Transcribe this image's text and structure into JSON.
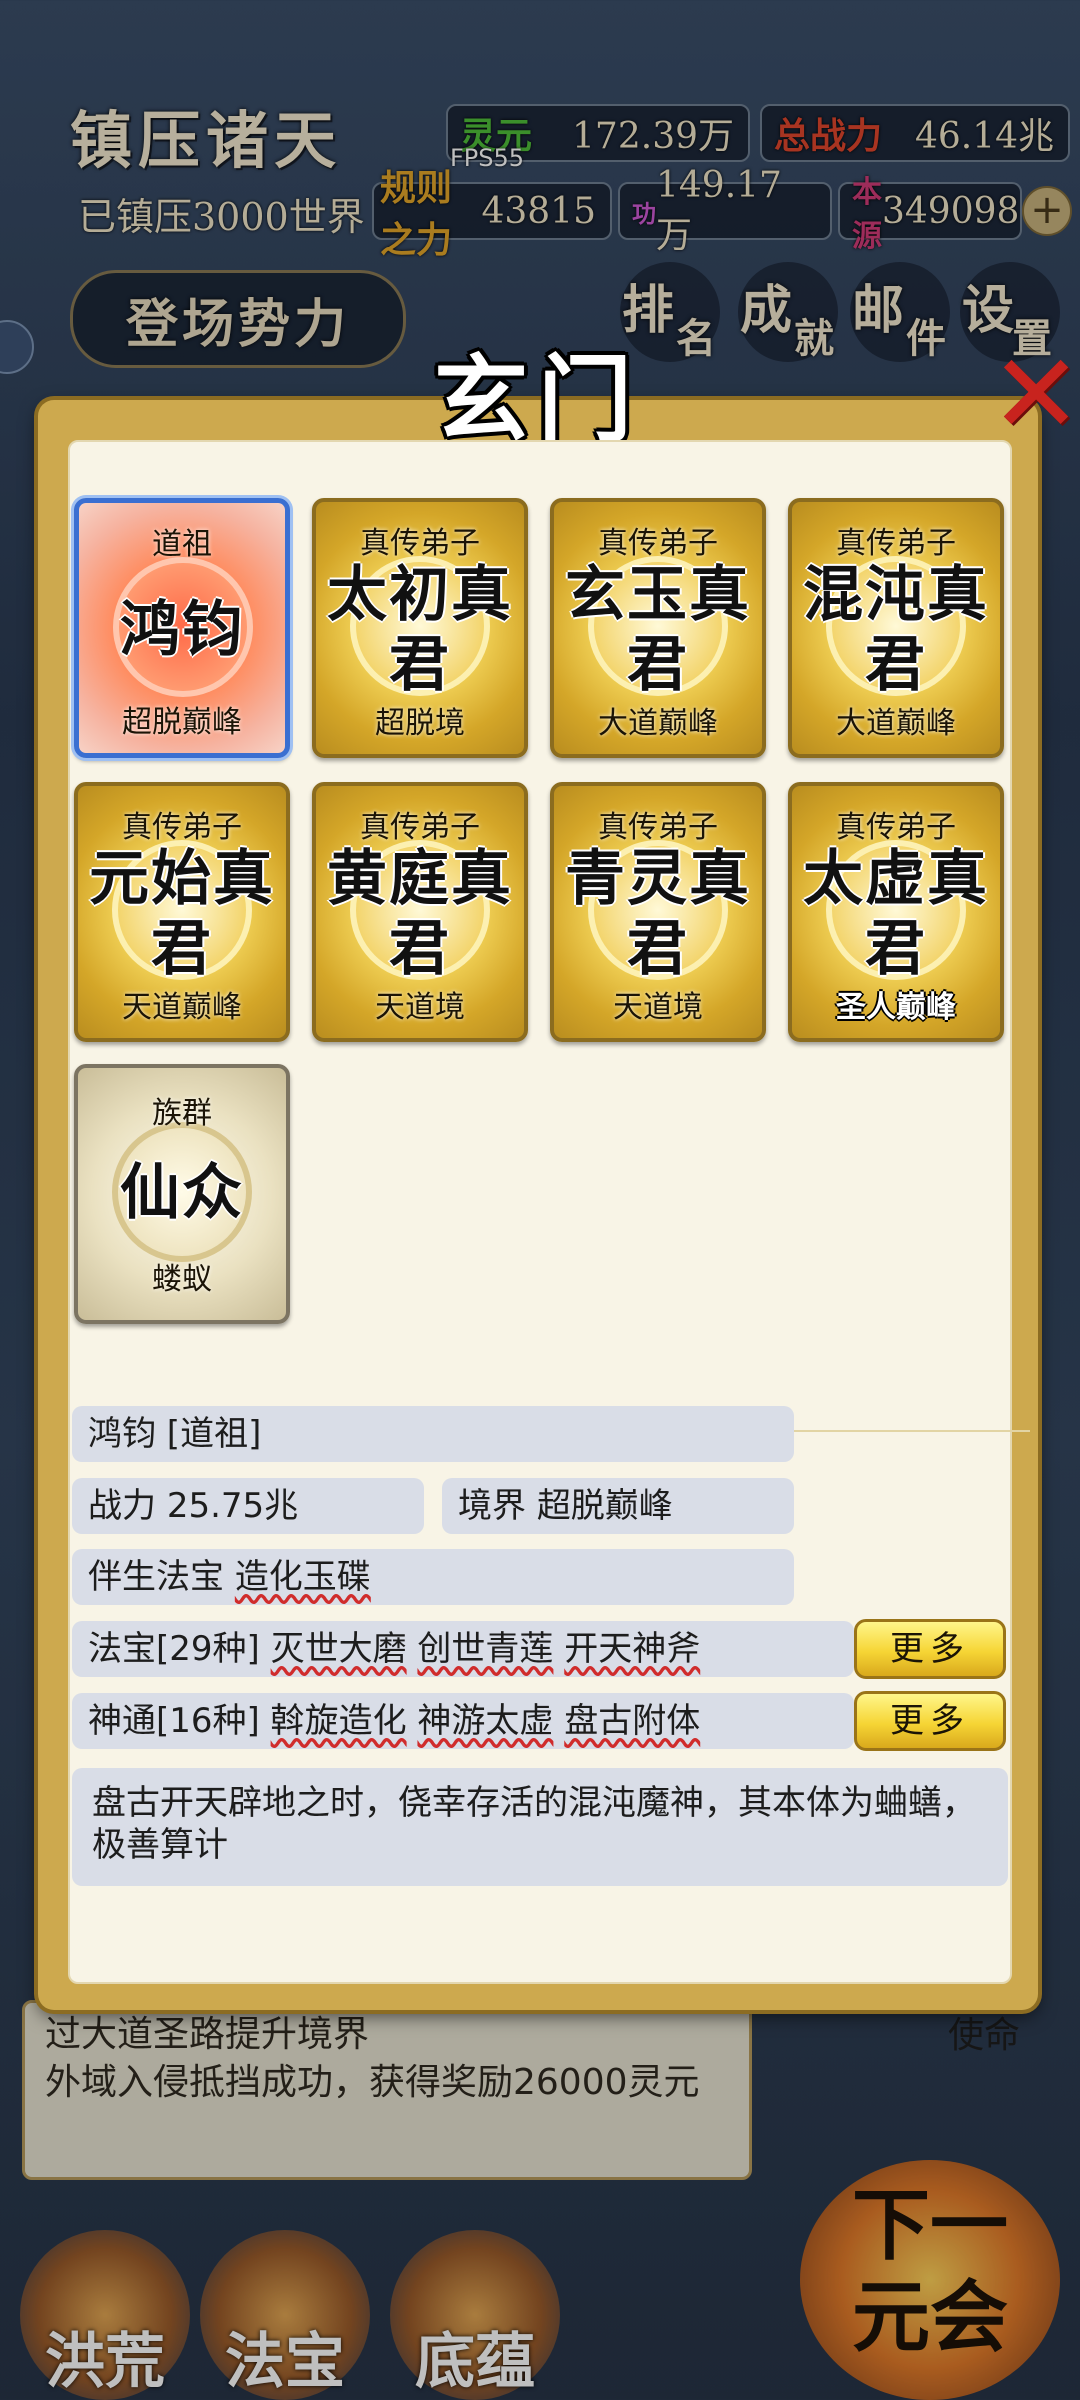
{
  "hud": {
    "title": "镇压诸天",
    "fps": "FPS55",
    "lingyuan_label": "灵元",
    "lingyuan_value": "172.39万",
    "power_label": "总战力",
    "power_value": "46.14兆",
    "worlds": "已镇压3000世界",
    "rule_label": "规则之力",
    "rule_value": "43815",
    "gong_label": "功",
    "gong_value": "149.17万",
    "benyuan_label": "本源",
    "benyuan_value": "349098",
    "plus": "+",
    "faction_tab": "登场势力",
    "buttons": [
      {
        "a": "排",
        "b": "名"
      },
      {
        "a": "成",
        "b": "就"
      },
      {
        "a": "邮",
        "b": "件"
      },
      {
        "a": "设",
        "b": "置"
      }
    ]
  },
  "background_log": {
    "line1": "过大道圣路提升境界",
    "line2": "外域入侵抵挡成功，获得奖励26000灵元",
    "mission": "使命"
  },
  "bottom_nav": [
    "洪荒",
    "法宝",
    "底蕴"
  ],
  "next_button": {
    "line1": "下一",
    "line2": "元会"
  },
  "modal": {
    "title": "玄门",
    "close": "✕",
    "cards": [
      {
        "role": "道祖",
        "name": "鸿钧",
        "realm": "超脱巅峰",
        "style": "selected"
      },
      {
        "role": "真传弟子",
        "name": "太初真君",
        "realm": "超脱境",
        "style": "gold"
      },
      {
        "role": "真传弟子",
        "name": "玄玉真君",
        "realm": "大道巅峰",
        "style": "gold"
      },
      {
        "role": "真传弟子",
        "name": "混沌真君",
        "realm": "大道巅峰",
        "style": "gold"
      },
      {
        "role": "真传弟子",
        "name": "元始真君",
        "realm": "天道巅峰",
        "style": "gold"
      },
      {
        "role": "真传弟子",
        "name": "黄庭真君",
        "realm": "天道境",
        "style": "gold"
      },
      {
        "role": "真传弟子",
        "name": "青灵真君",
        "realm": "天道境",
        "style": "gold"
      },
      {
        "role": "真传弟子",
        "name": "太虚真君",
        "realm": "圣人巅峰",
        "style": "gold"
      },
      {
        "role": "族群",
        "name": "仙众",
        "realm": "蝼蚁",
        "style": "silver"
      }
    ],
    "detail": {
      "header": "鸿钧 [道祖]",
      "power_label": "战力",
      "power_value": "25.75兆",
      "realm_label": "境界",
      "realm_value": "超脱巅峰",
      "companion_label": "伴生法宝",
      "companion_value": "造化玉碟",
      "treasures_label": "法宝[29种]",
      "treasures": [
        "灭世大磨",
        "创世青莲",
        "开天神斧"
      ],
      "skills_label": "神通[16种]",
      "skills": [
        "斡旋造化",
        "神游太虚",
        "盘古附体"
      ],
      "more_label": "更多",
      "description": "盘古开天辟地之时，侥幸存活的混沌魔神，其本体为蛐蟮，极善算计"
    }
  }
}
